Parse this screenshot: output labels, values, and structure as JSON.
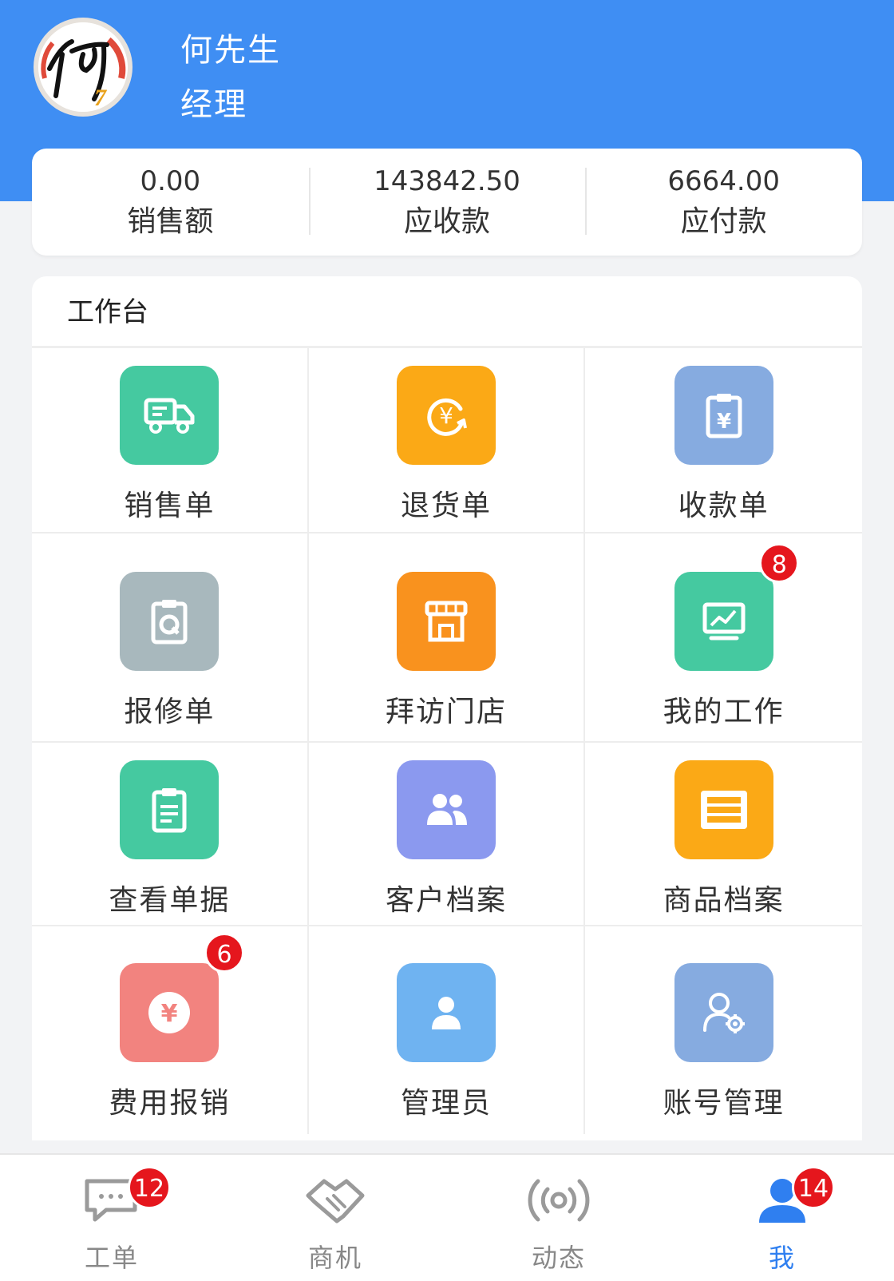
{
  "profile": {
    "name": "何先生",
    "role": "经理",
    "avatar_text": "何"
  },
  "stats": [
    {
      "value": "0.00",
      "label": "销售额"
    },
    {
      "value": "143842.50",
      "label": "应收款"
    },
    {
      "value": "6664.00",
      "label": "应付款"
    }
  ],
  "workbench": {
    "title": "工作台",
    "items": [
      {
        "label": "销售单",
        "icon": "truck-icon",
        "color": "#45c9a0"
      },
      {
        "label": "退货单",
        "icon": "yen-refresh-icon",
        "color": "#fba916"
      },
      {
        "label": "收款单",
        "icon": "clipboard-yen-icon",
        "color": "#86abe0"
      },
      {
        "label": "报修单",
        "icon": "clipboard-wrench-icon",
        "color": "#a8b8bd"
      },
      {
        "label": "拜访门店",
        "icon": "storefront-icon",
        "color": "#f9921e"
      },
      {
        "label": "我的工作",
        "icon": "chart-monitor-icon",
        "color": "#45c9a0",
        "badge": "8"
      },
      {
        "label": "查看单据",
        "icon": "document-icon",
        "color": "#45c9a0"
      },
      {
        "label": "客户档案",
        "icon": "users-icon",
        "color": "#8b99ef"
      },
      {
        "label": "商品档案",
        "icon": "list-icon",
        "color": "#fba916"
      },
      {
        "label": "费用报销",
        "icon": "yen-circle-icon",
        "color": "#f2837f",
        "badge": "6"
      },
      {
        "label": "管理员",
        "icon": "person-icon",
        "color": "#6fb3f1"
      },
      {
        "label": "账号管理",
        "icon": "user-gear-icon",
        "color": "#86abe0"
      }
    ]
  },
  "tabbar": [
    {
      "label": "工单",
      "icon": "message-icon",
      "badge": "12",
      "active": false
    },
    {
      "label": "商机",
      "icon": "handshake-icon",
      "active": false
    },
    {
      "label": "动态",
      "icon": "broadcast-icon",
      "active": false
    },
    {
      "label": "我",
      "icon": "user-icon",
      "badge": "14",
      "active": true
    }
  ],
  "colors": {
    "header_blue": "#3f8ef3",
    "badge_red": "#e5161d",
    "tab_active": "#2f7ff0",
    "tab_inactive": "#888888"
  }
}
